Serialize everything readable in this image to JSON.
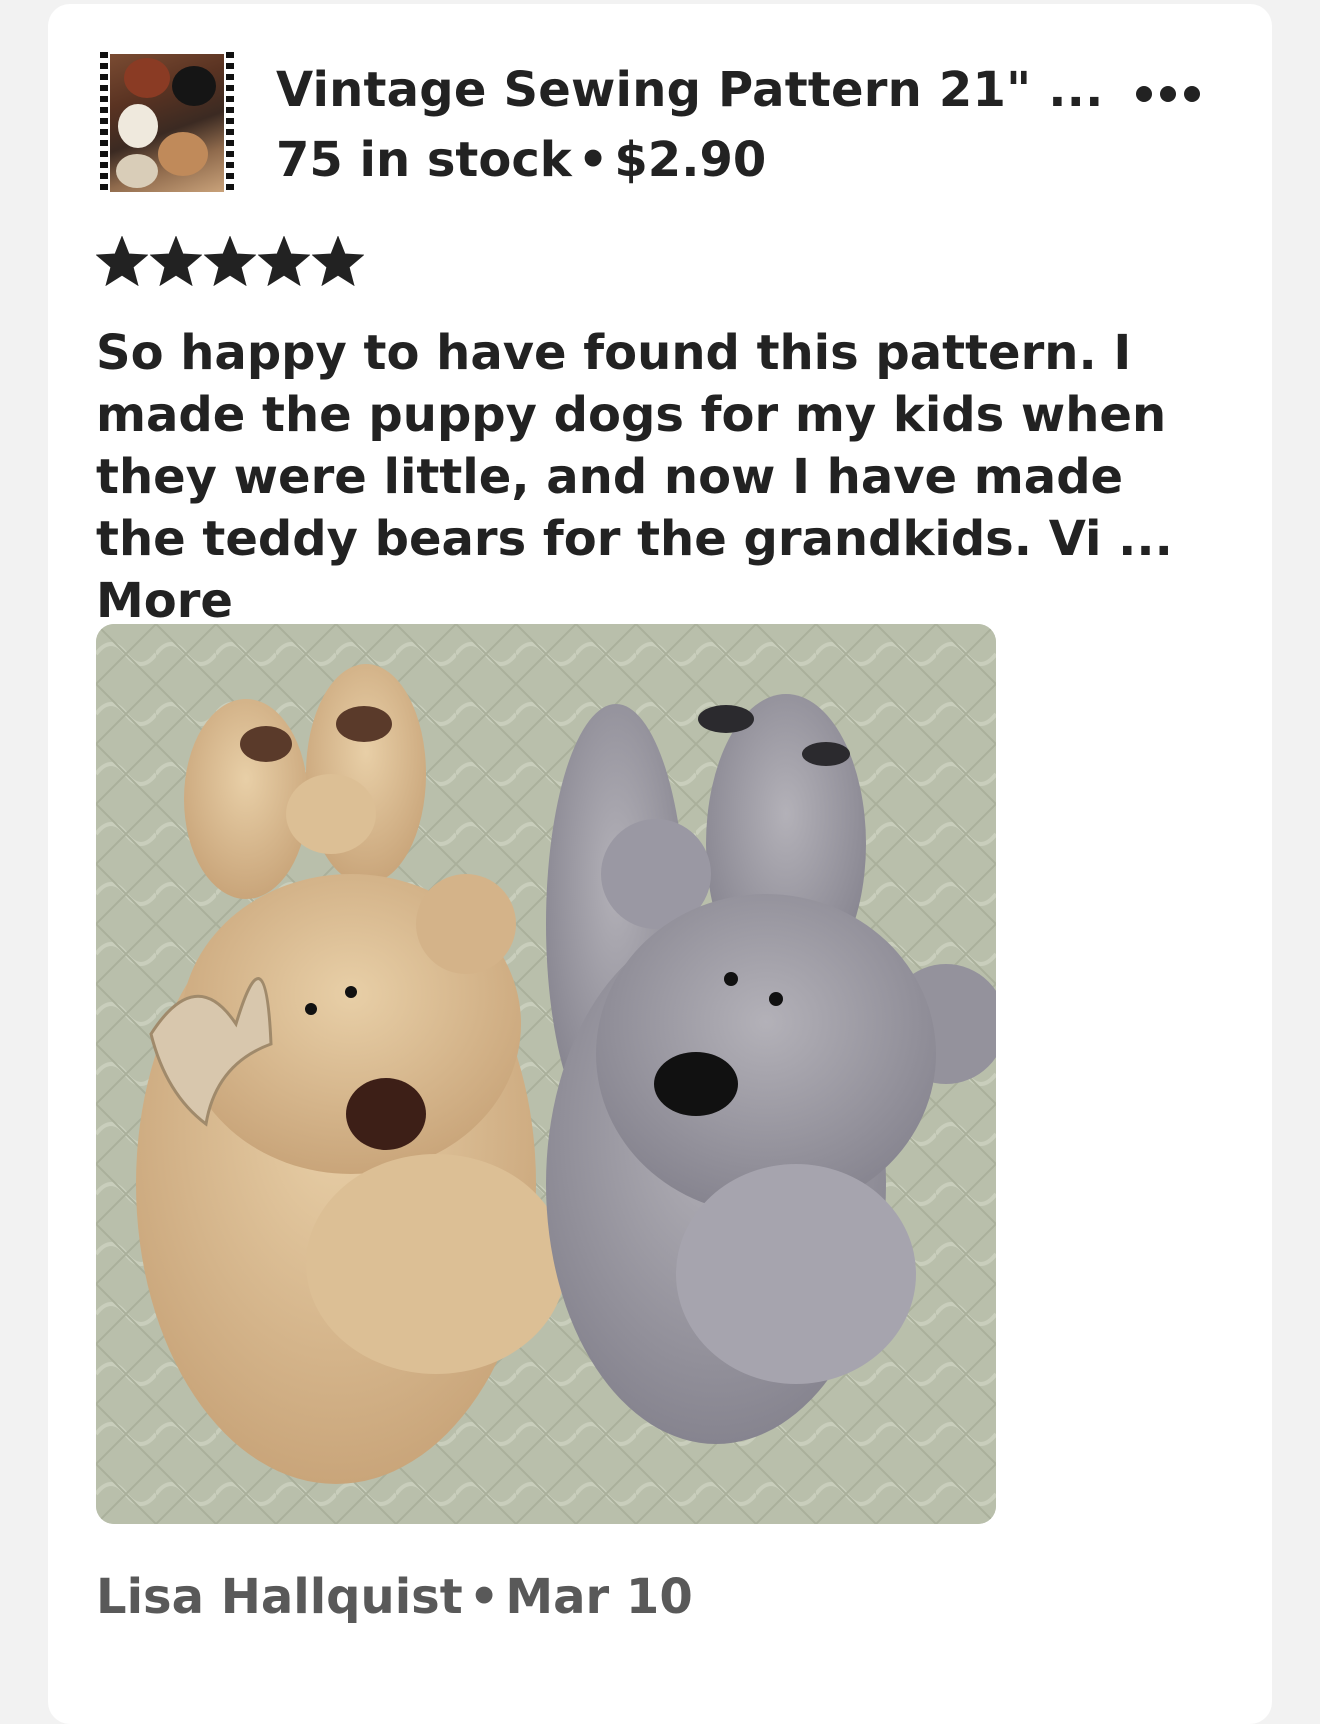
{
  "listing": {
    "title": "Vintage Sewing Pattern 21\" ...",
    "stock": "75 in stock",
    "separator": "•",
    "price": "$2.90",
    "thumbnail_icon": "listing-thumbnail-teddy-bears"
  },
  "menu": {
    "icon": "more-options-icon"
  },
  "review": {
    "rating": 5,
    "rating_max": 5,
    "text": "So happy to have found this pattern.  I made the puppy dogs for my kids when they were little, and now I have made the teddy bears for the grandkids.  Vi ... ",
    "more_label": "More",
    "photo_icon": "review-photo-teddy-bears"
  },
  "author": {
    "name": "Lisa Hallquist",
    "separator": "•",
    "date": "Mar 10"
  },
  "colors": {
    "text": "#222222",
    "muted": "#595959",
    "background": "#f2f2f2",
    "card": "#ffffff",
    "star": "#222222"
  }
}
